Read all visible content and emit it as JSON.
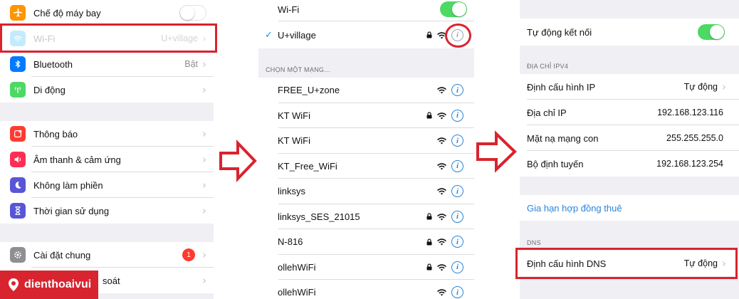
{
  "panel1": {
    "airplane_label": "Chế độ máy bay",
    "wifi_label": "Wi-Fi",
    "wifi_value": "U+village",
    "bluetooth_label": "Bluetooth",
    "bluetooth_value": "Bật",
    "cellular_label": "Di động",
    "notifications_label": "Thông báo",
    "sounds_label": "Âm thanh & cảm ứng",
    "dnd_label": "Không làm phiền",
    "screentime_label": "Thời gian sử dụng",
    "general_label": "Cài đặt chung",
    "general_badge": "1",
    "control_label": "soát"
  },
  "panel2": {
    "wifi_label": "Wi-Fi",
    "connected_check": "✓",
    "connected_network": "U+village",
    "section_header": "CHỌN MỘT MẠNG...",
    "networks": [
      {
        "name": "FREE_U+zone",
        "locked": false
      },
      {
        "name": "KT WiFi",
        "locked": true
      },
      {
        "name": "KT WiFi",
        "locked": false
      },
      {
        "name": "KT_Free_WiFi",
        "locked": false
      },
      {
        "name": "linksys",
        "locked": false
      },
      {
        "name": "linksys_SES_21015",
        "locked": true
      },
      {
        "name": "N-816",
        "locked": true
      },
      {
        "name": "ollehWiFi",
        "locked": true
      },
      {
        "name": "ollehWiFi",
        "locked": false
      }
    ]
  },
  "panel3": {
    "auto_join_label": "Tự động kết nối",
    "ipv4_header": "ĐỊA CHỈ IPV4",
    "configure_ip_label": "Định cấu hình IP",
    "configure_ip_value": "Tự động",
    "ip_address_label": "Địa chỉ IP",
    "ip_address_value": "192.168.123.116",
    "subnet_label": "Mặt nạ mạng con",
    "subnet_value": "255.255.255.0",
    "router_label": "Bộ định tuyến",
    "router_value": "192.168.123.254",
    "renew_lease_label": "Gia hạn hợp đồng thuê",
    "dns_header": "DNS",
    "configure_dns_label": "Định cấu hình DNS",
    "configure_dns_value": "Tự động"
  },
  "logo": {
    "text": "dienthoaivui"
  },
  "colors": {
    "highlight": "#d9232e",
    "toggle_on": "#4cd964",
    "link_blue": "#2b84d9",
    "airplane_icon": "#ff9500",
    "wifi_icon": "#5ac8fa",
    "bluetooth_icon": "#007aff",
    "cellular_icon": "#4cd964",
    "notifications_icon": "#ff3b30",
    "sounds_icon": "#ff2d55",
    "dnd_icon": "#5856d6",
    "screentime_icon": "#5856d6",
    "general_icon": "#8e8e93"
  },
  "icons": [
    "airplane-icon",
    "wifi-icon",
    "bluetooth-icon",
    "cellular-icon",
    "notifications-icon",
    "sounds-icon",
    "moon-icon",
    "hourglass-icon",
    "gear-icon",
    "lock-icon",
    "wifi-signal-icon",
    "info-icon",
    "checkmark-icon",
    "chevron-right-icon",
    "arrow-right-icon"
  ]
}
